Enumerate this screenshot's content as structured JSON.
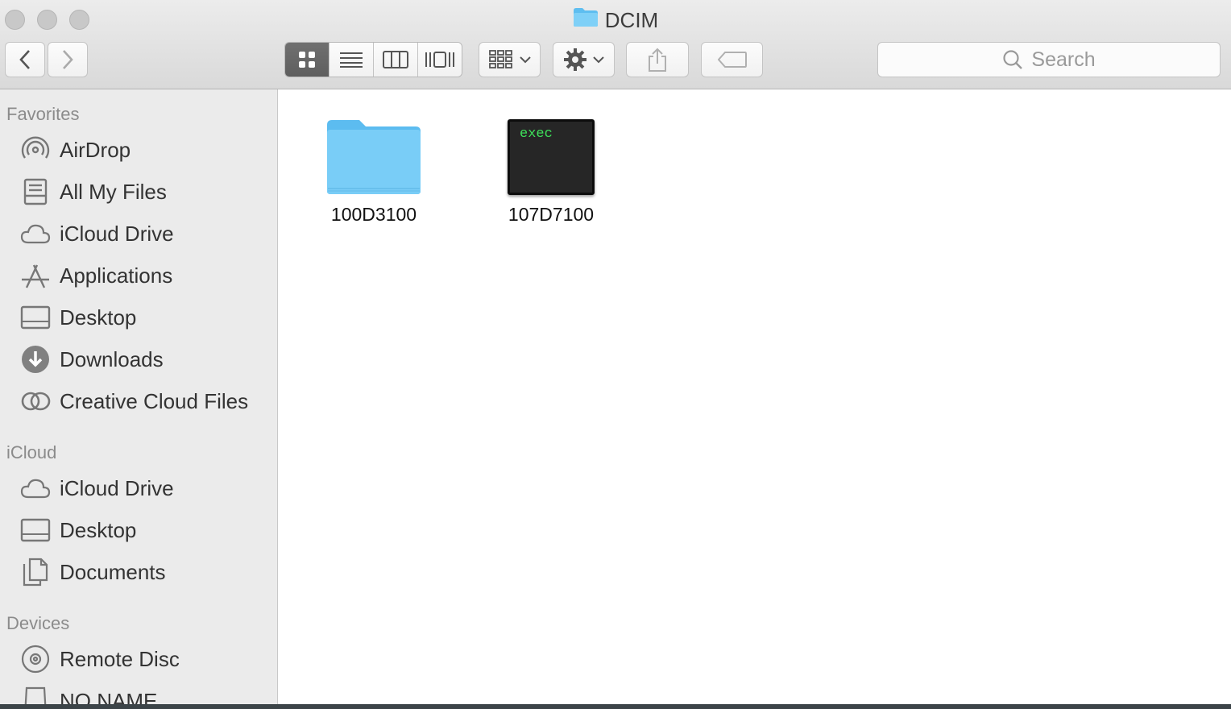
{
  "window": {
    "title": "DCIM"
  },
  "toolbar": {
    "view_modes": [
      "icon-view",
      "list-view",
      "column-view",
      "cover-flow-view"
    ],
    "active_view": "icon-view",
    "search_placeholder": "Search"
  },
  "sidebar": {
    "favorites_header": "Favorites",
    "favorites": [
      {
        "label": "AirDrop",
        "icon": "airdrop-icon"
      },
      {
        "label": "All My Files",
        "icon": "all-my-files-icon"
      },
      {
        "label": "iCloud Drive",
        "icon": "cloud-icon"
      },
      {
        "label": "Applications",
        "icon": "applications-icon"
      },
      {
        "label": "Desktop",
        "icon": "desktop-icon"
      },
      {
        "label": "Downloads",
        "icon": "downloads-icon"
      },
      {
        "label": "Creative Cloud Files",
        "icon": "creative-cloud-icon"
      }
    ],
    "icloud_header": "iCloud",
    "icloud": [
      {
        "label": "iCloud Drive",
        "icon": "cloud-icon"
      },
      {
        "label": "Desktop",
        "icon": "desktop-icon"
      },
      {
        "label": "Documents",
        "icon": "documents-icon"
      }
    ],
    "devices_header": "Devices",
    "devices": [
      {
        "label": "Remote Disc",
        "icon": "disc-icon"
      },
      {
        "label": "NO NAME",
        "icon": "drive-icon"
      }
    ]
  },
  "files": [
    {
      "name": "100D3100",
      "kind": "folder"
    },
    {
      "name": "107D7100",
      "kind": "executable",
      "badge": "exec"
    }
  ]
}
